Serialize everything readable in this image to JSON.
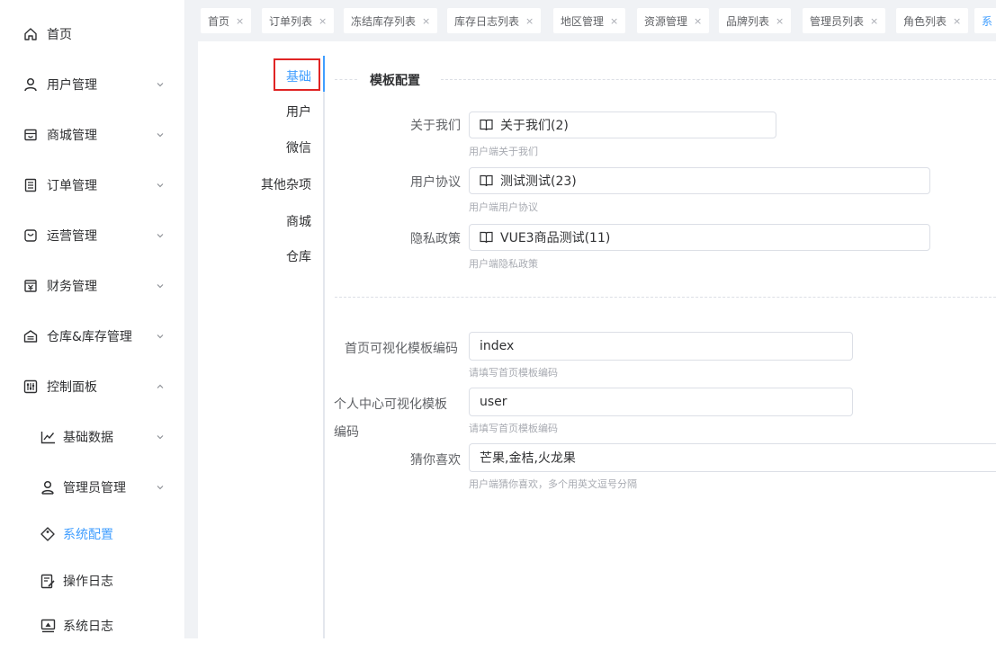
{
  "colors": {
    "accent": "#409eff",
    "highlight": "#e02424",
    "text": "#303133",
    "hint": "#a8abb2"
  },
  "sidebar": {
    "items": [
      {
        "label": "首页",
        "icon": "home-icon",
        "arrow": "none"
      },
      {
        "label": "用户管理",
        "icon": "user-icon",
        "arrow": "down"
      },
      {
        "label": "商城管理",
        "icon": "shop-icon",
        "arrow": "down"
      },
      {
        "label": "订单管理",
        "icon": "list-icon",
        "arrow": "down"
      },
      {
        "label": "运营管理",
        "icon": "operation-icon",
        "arrow": "down"
      },
      {
        "label": "财务管理",
        "icon": "finance-icon",
        "arrow": "down"
      },
      {
        "label": "仓库&库存管理",
        "icon": "warehouse-icon",
        "arrow": "down"
      },
      {
        "label": "控制面板",
        "icon": "control-panel-icon",
        "arrow": "up"
      },
      {
        "label": "基础数据",
        "icon": "chart-line-icon",
        "arrow": "down"
      },
      {
        "label": "管理员管理",
        "icon": "admin-user-icon",
        "arrow": "down"
      },
      {
        "label": "系统配置",
        "icon": "system-config-icon",
        "arrow": "none",
        "active": true
      },
      {
        "label": "操作日志",
        "icon": "edit-log-icon",
        "arrow": "none"
      },
      {
        "label": "系统日志",
        "icon": "monitor-icon",
        "arrow": "none"
      }
    ]
  },
  "tabs": [
    {
      "label": "首页",
      "close": "×"
    },
    {
      "label": "订单列表",
      "close": "×"
    },
    {
      "label": "冻结库存列表",
      "close": "×"
    },
    {
      "label": "库存日志列表",
      "close": "×"
    },
    {
      "label": "地区管理",
      "close": "×"
    },
    {
      "label": "资源管理",
      "close": "×"
    },
    {
      "label": "品牌列表",
      "close": "×"
    },
    {
      "label": "管理员列表",
      "close": "×"
    },
    {
      "label": "角色列表",
      "close": "×"
    },
    {
      "label": "系",
      "close": ""
    }
  ],
  "settings_tabs": [
    "基础",
    "用户",
    "微信",
    "其他杂项",
    "商城",
    "仓库"
  ],
  "form": {
    "section_title": "模板配置",
    "about_label": "关于我们",
    "about_value": "关于我们(2)",
    "about_hint": "用户端关于我们",
    "agreement_label": "用户协议",
    "agreement_value": "测试测试(23)",
    "agreement_hint": "用户端用户协议",
    "privacy_label": "隐私政策",
    "privacy_value": "VUE3商品测试(11)",
    "privacy_hint": "用户端隐私政策",
    "home_tpl_label": "首页可视化模板编码",
    "home_tpl_value": "index",
    "home_tpl_hint": "请填写首页模板编码",
    "user_tpl_label_1": "个人中心可视化模板",
    "user_tpl_label_2": "编码",
    "user_tpl_value": "user",
    "user_tpl_hint": "请填写首页模板编码",
    "guess_label": "猜你喜欢",
    "guess_value": "芒果,金桔,火龙果",
    "guess_hint": "用户端猜你喜欢，多个用英文逗号分隔"
  }
}
